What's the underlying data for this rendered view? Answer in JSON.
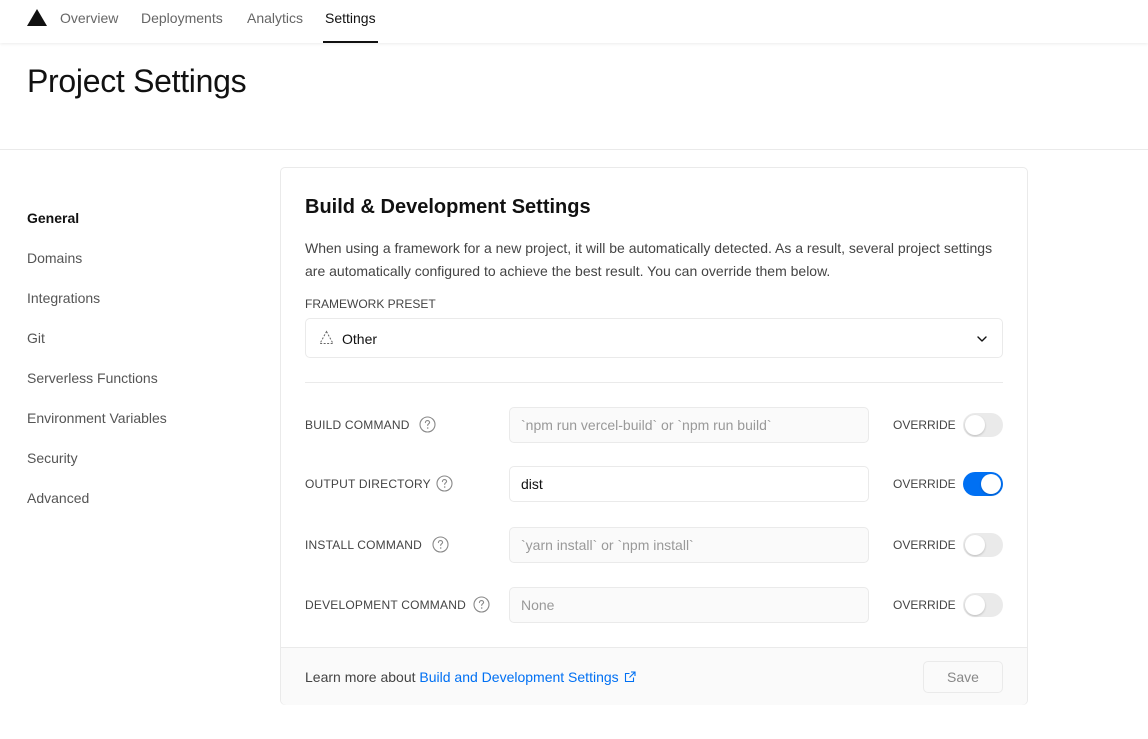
{
  "nav": {
    "logo": "vercel-triangle-logo",
    "tabs": [
      {
        "label": "Overview",
        "active": false
      },
      {
        "label": "Deployments",
        "active": false
      },
      {
        "label": "Analytics",
        "active": false
      },
      {
        "label": "Settings",
        "active": true
      }
    ]
  },
  "header": {
    "title": "Project Settings"
  },
  "sidebar": {
    "items": [
      {
        "label": "General",
        "active": true
      },
      {
        "label": "Domains",
        "active": false
      },
      {
        "label": "Integrations",
        "active": false
      },
      {
        "label": "Git",
        "active": false
      },
      {
        "label": "Serverless Functions",
        "active": false
      },
      {
        "label": "Environment Variables",
        "active": false
      },
      {
        "label": "Security",
        "active": false
      },
      {
        "label": "Advanced",
        "active": false
      }
    ]
  },
  "card": {
    "title": "Build & Development Settings",
    "description": "When using a framework for a new project, it will be automatically detected. As a result, several project settings are automatically configured to achieve the best result. You can override them below.",
    "framework_preset": {
      "label": "FRAMEWORK PRESET",
      "value": "Other",
      "icon": "triangle-outline-icon"
    },
    "rows": [
      {
        "label": "BUILD COMMAND",
        "value": "",
        "placeholder": "`npm run vercel-build` or `npm run build`",
        "override_label": "OVERRIDE",
        "override": false
      },
      {
        "label": "OUTPUT DIRECTORY",
        "value": "dist",
        "placeholder": "",
        "override_label": "OVERRIDE",
        "override": true
      },
      {
        "label": "INSTALL COMMAND",
        "value": "",
        "placeholder": "`yarn install` or `npm install`",
        "override_label": "OVERRIDE",
        "override": false
      },
      {
        "label": "DEVELOPMENT COMMAND",
        "value": "",
        "placeholder": "None",
        "override_label": "OVERRIDE",
        "override": false
      }
    ],
    "footer": {
      "text": "Learn more about ",
      "link_label": "Build and Development Settings",
      "save_label": "Save"
    }
  },
  "colors": {
    "accent": "#0070f3",
    "border": "#eaeaea",
    "muted_bg": "#fafafa"
  }
}
